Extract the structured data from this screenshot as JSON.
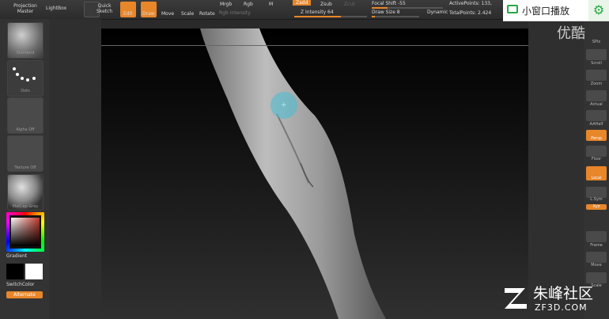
{
  "toolbar": {
    "projection_master": "Projection\nMaster",
    "lightbox": "LightBox",
    "quick_sketch": "Quick\nSketch",
    "edit": "Edit",
    "draw": "Draw",
    "move": "Move",
    "scale": "Scale",
    "rotate": "Rotate",
    "mrgb": "Mrgb",
    "rgb": "Rgb",
    "m": "M",
    "zadd": "Zadd",
    "zsub": "Zsub",
    "zcut": "Zcut",
    "rgb_intensity": "Rgb Intensity",
    "z_intensity": "Z Intensity 64",
    "focal_shift": "Focal Shift -55",
    "draw_size": "Draw Size 8",
    "dynamic": "Dynamic",
    "active_points": "ActivePoints: 133,",
    "total_points": "TotalPoints: 2.424"
  },
  "left": {
    "brush_label": "Standard",
    "stroke_label": "Dots",
    "alpha_label": "Alpha Off",
    "texture_label": "Texture Off",
    "material_label": "MatCap Gray",
    "gradient": "Gradient",
    "switch_color": "SwitchColor",
    "alternate": "Alternate"
  },
  "right": {
    "items": [
      "SPix",
      "Scroll",
      "Zoom",
      "Actual",
      "AAHalf",
      "Persp",
      "Floor",
      "Local",
      "L.Sym",
      "Xyz",
      "Frame",
      "Move",
      "Scale"
    ]
  },
  "popup": {
    "label": "小窗口播放"
  },
  "watermarks": {
    "youku": "优酷",
    "zf_cn": "朱峰社区",
    "zf_url": "ZF3D.COM"
  },
  "colors": {
    "accent": "#e8862a",
    "popup_green": "#27a844"
  }
}
